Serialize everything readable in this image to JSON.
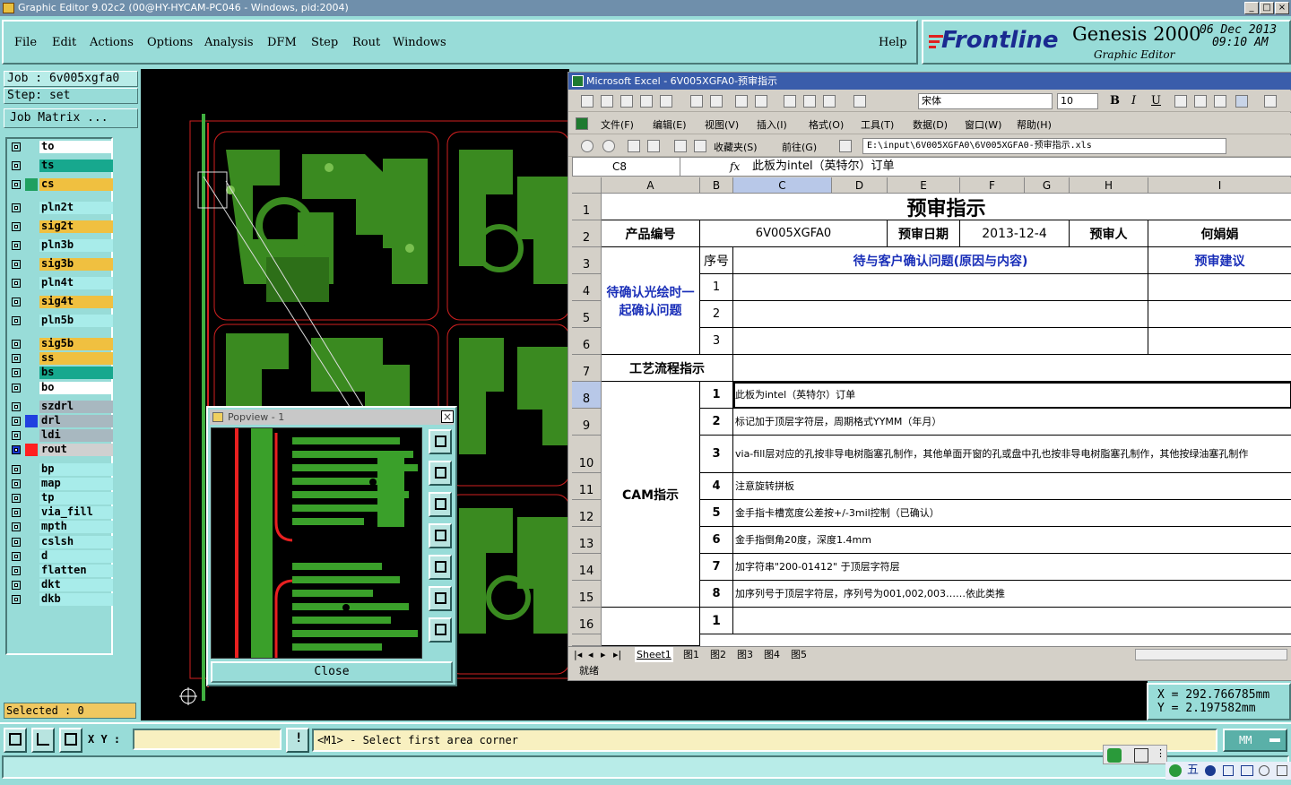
{
  "window": {
    "title": "Graphic Editor 9.02c2 (00@HY-HYCAM-PC046 - Windows, pid:2004)",
    "btn_min": "_",
    "btn_max": "□",
    "btn_close": "×"
  },
  "menu": {
    "items": [
      "File",
      "Edit",
      "Actions",
      "Options",
      "Analysis",
      "DFM",
      "Step",
      "Rout",
      "Windows"
    ],
    "help": "Help"
  },
  "brand": {
    "logo": "Frontline",
    "product": "Genesis 2000",
    "subtitle": "Graphic Editor",
    "date": "06 Dec 2013",
    "time": "09:10 AM"
  },
  "job": {
    "job_label": "Job : 6v005xgfa0",
    "step_label": "Step: set",
    "matrix_button": "Job Matrix ..."
  },
  "layers": [
    {
      "name": "to",
      "color": "#ffffff"
    },
    {
      "name": "ts",
      "color": "#17a88e"
    },
    {
      "name": "cs",
      "color": "#f0c040",
      "swatch": "#20a060"
    },
    {
      "name": "pln2t",
      "color": "#a8ecea"
    },
    {
      "name": "sig2t",
      "color": "#f0c040"
    },
    {
      "name": "pln3b",
      "color": "#a8ecea"
    },
    {
      "name": "sig3b",
      "color": "#f0c040"
    },
    {
      "name": "pln4t",
      "color": "#a8ecea"
    },
    {
      "name": "sig4t",
      "color": "#f0c040"
    },
    {
      "name": "pln5b",
      "color": "#a8ecea"
    },
    {
      "name": "sig5b",
      "color": "#f0c040"
    },
    {
      "name": "ss",
      "color": "#f0c040"
    },
    {
      "name": "bs",
      "color": "#17a88e"
    },
    {
      "name": "bo",
      "color": "#ffffff"
    },
    {
      "name": "szdrl",
      "color": "#a8b8c0"
    },
    {
      "name": "drl",
      "color": "#a8b8c0",
      "swatch": "#2040e0"
    },
    {
      "name": "ldi",
      "color": "#a8b8c0"
    },
    {
      "name": "rout",
      "color": "#d0d0d0",
      "swatch": "#ff2020",
      "checkbox": "#1a3ad0"
    },
    {
      "name": "bp",
      "color": "#a8ecea"
    },
    {
      "name": "map",
      "color": "#a8ecea"
    },
    {
      "name": "tp",
      "color": "#a8ecea"
    },
    {
      "name": "via_fill",
      "color": "#a8ecea"
    },
    {
      "name": "mpth",
      "color": "#a8ecea"
    },
    {
      "name": "cslsh",
      "color": "#a8ecea"
    },
    {
      "name": "d",
      "color": "#a8ecea"
    },
    {
      "name": "flatten",
      "color": "#a8ecea"
    },
    {
      "name": "dkt",
      "color": "#a8ecea"
    },
    {
      "name": "dkb",
      "color": "#a8ecea"
    }
  ],
  "popview": {
    "title": "Popview - 1",
    "close_label": "Close"
  },
  "excel": {
    "title": "Microsoft Excel - 6V005XGFA0-预审指示",
    "menus": [
      "文件(F)",
      "编辑(E)",
      "视图(V)",
      "插入(I)",
      "格式(O)",
      "工具(T)",
      "数据(D)",
      "窗口(W)",
      "帮助(H)"
    ],
    "font": "宋体",
    "font_size": "10",
    "web": {
      "favorites": "收藏夹(S)",
      "go": "前往(G)",
      "path": "E:\\input\\6V005XGFA0\\6V005XGFA0-预审指示.xls"
    },
    "name_box": "C8",
    "fx": "fx",
    "formula": "此板为intel（英特尔）订单",
    "columns": [
      "A",
      "B",
      "C",
      "D",
      "E",
      "F",
      "G",
      "H",
      "I"
    ],
    "rows": [
      "1",
      "2",
      "3",
      "4",
      "5",
      "6",
      "7",
      "8",
      "9",
      "10",
      "11",
      "12",
      "13",
      "14",
      "15",
      "16"
    ],
    "cells": {
      "title": "预审指示",
      "product_no_label": "产品编号",
      "product_no": "6V005XGFA0",
      "review_date_label": "预审日期",
      "review_date": "2013-12-4",
      "reviewer_label": "预审人",
      "reviewer": "何娟娟",
      "pending_label": "待确认光绘时一起确认问题",
      "seq_label": "序号",
      "issue_label": "待与客户确认问题(原因与内容)",
      "advice_label": "预审建议",
      "pending_nums": [
        "1",
        "2",
        "3"
      ],
      "process_label": "工艺流程指示",
      "cam_label": "CAM指示",
      "cam_items": [
        {
          "n": "1",
          "t": "此板为intel（英特尔）订单"
        },
        {
          "n": "2",
          "t": "标记加于顶层字符层，周期格式YYMM（年月）"
        },
        {
          "n": "3",
          "t": "via-fill层对应的孔按非导电树脂塞孔制作，其他单面开窗的孔或盘中孔也按非导电树脂塞孔制作，其他按绿油塞孔制作"
        },
        {
          "n": "4",
          "t": "注意旋转拼板"
        },
        {
          "n": "5",
          "t": "金手指卡槽宽度公差按+/-3mil控制（已确认）"
        },
        {
          "n": "6",
          "t": "金手指倒角20度，深度1.4mm"
        },
        {
          "n": "7",
          "t": "加字符串\"200-01412\" 于顶层字符层"
        },
        {
          "n": "8",
          "t": "加序列号于顶层字符层，序列号为001,002,003……依此类推"
        }
      ],
      "row16_num": "1"
    },
    "sheets": [
      "Sheet1",
      "图1",
      "图2",
      "图3",
      "图4",
      "图5"
    ],
    "status": "就绪"
  },
  "coords": {
    "x": "X = 292.766785mm",
    "y": "Y = 2.197582mm"
  },
  "selected": "Selected : 0",
  "bottom": {
    "xy_label": "X Y :",
    "message": "<M1> - Select first area corner",
    "unit": "MM"
  },
  "ime": "五"
}
